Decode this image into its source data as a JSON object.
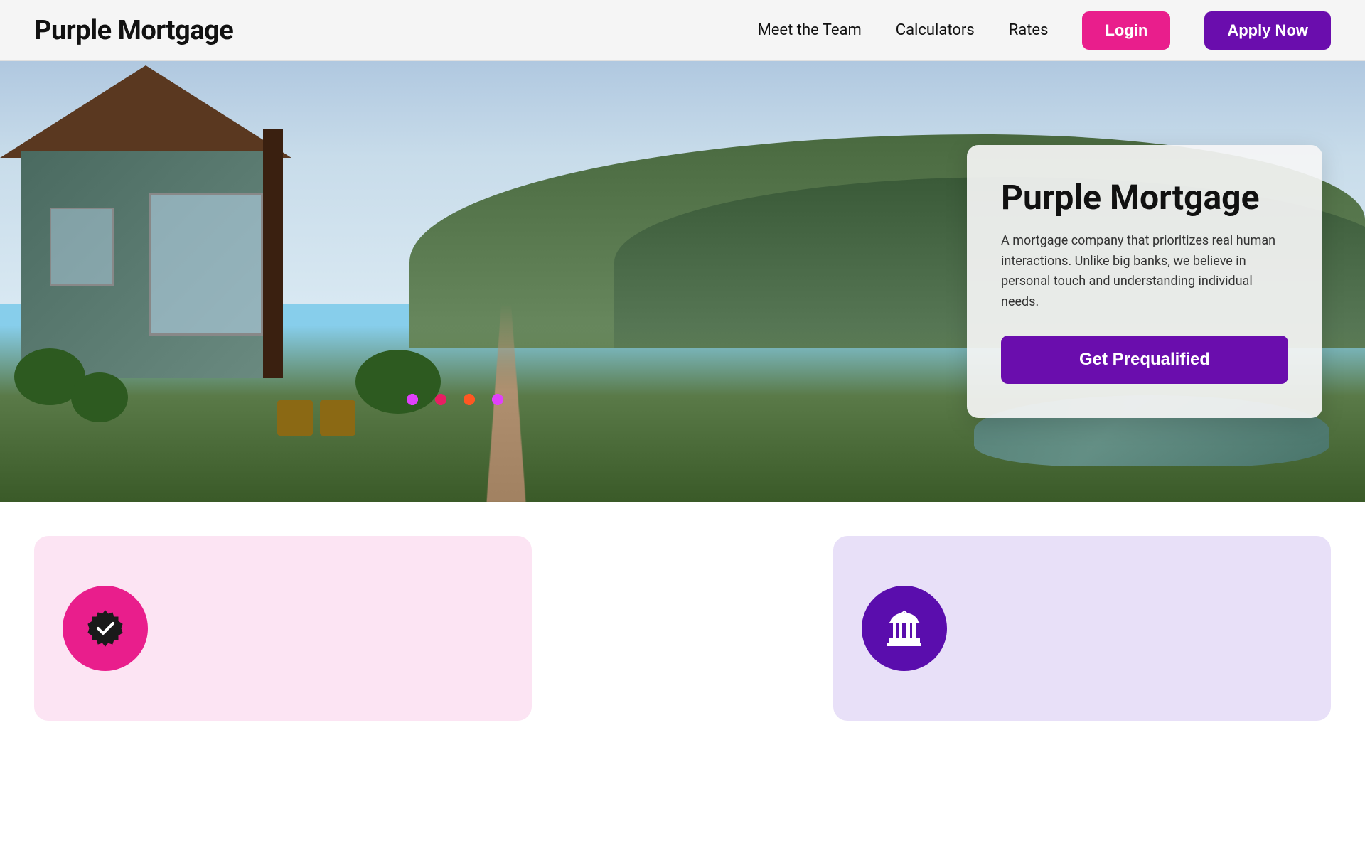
{
  "header": {
    "logo": "Purple Mortgage",
    "nav": {
      "meet_team": "Meet the Team",
      "calculators": "Calculators",
      "rates": "Rates",
      "login": "Login",
      "apply_now": "Apply Now"
    }
  },
  "hero": {
    "card": {
      "title": "Purple Mortgage",
      "description": "A mortgage company that prioritizes real human interactions. Unlike big banks, we believe in personal touch and understanding individual needs.",
      "cta": "Get Prequalified"
    }
  },
  "cards": [
    {
      "id": "card-pink",
      "icon": "check-badge"
    },
    {
      "id": "card-purple",
      "icon": "bank-building"
    }
  ],
  "colors": {
    "brand_purple": "#6a0dad",
    "brand_pink": "#e91e8c",
    "card_pink_bg": "#fce4f3",
    "card_purple_bg": "#e8e0f8"
  }
}
